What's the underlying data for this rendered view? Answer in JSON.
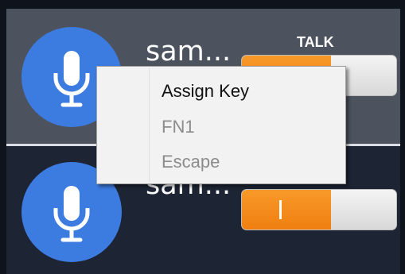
{
  "channels": [
    {
      "name": "sam...",
      "talk_label": "TALK",
      "icon": "microphone-icon",
      "toggle": "on"
    },
    {
      "name": "sam...",
      "icon": "microphone-icon",
      "toggle": "on",
      "toggle_mark": "|"
    }
  ],
  "context_menu": {
    "items": [
      {
        "label": "Assign Key",
        "enabled": true
      },
      {
        "label": "FN1",
        "enabled": false
      },
      {
        "label": "Escape",
        "enabled": false
      }
    ]
  },
  "colors": {
    "accent_orange": "#f28a1c",
    "avatar_blue": "#3c7be0",
    "row_selected_bg": "#4c535e",
    "row_bg": "#1d2434"
  }
}
